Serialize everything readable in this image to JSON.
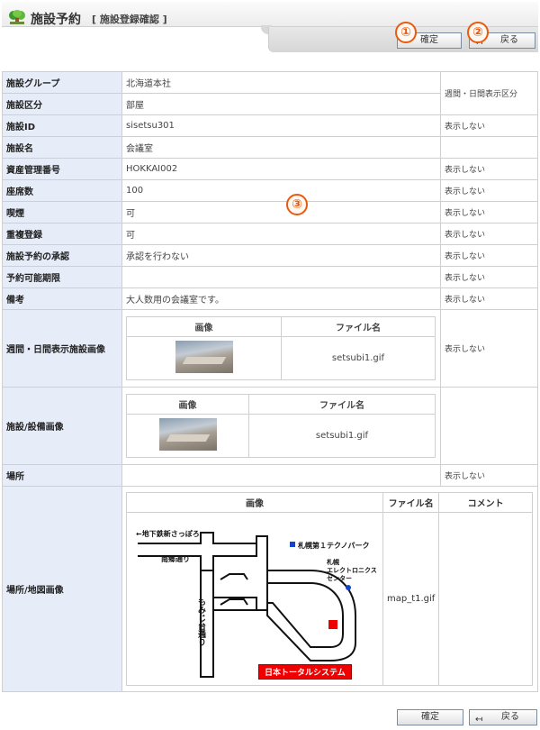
{
  "header": {
    "title": "施設予約",
    "subtitle": "[ 施設登録確認 ]",
    "app_icon": "facility-tree-icon"
  },
  "toolbar": {
    "confirm_label": "確定",
    "back_label": "戻る",
    "back_icon": "return-arrow-icon",
    "badge_1": "①",
    "badge_2": "②"
  },
  "badge_3": "③",
  "table": {
    "display_header": "週間・日間表示区分",
    "rows": [
      {
        "label": "施設グループ",
        "value": "北海道本社",
        "display": ""
      },
      {
        "label": "施設区分",
        "value": "部屋",
        "display": ""
      },
      {
        "label": "施設ID",
        "value": "sisetsu301",
        "display": "表示しない"
      },
      {
        "label": "施設名",
        "value": "会議室",
        "display": ""
      },
      {
        "label": "資産管理番号",
        "value": "HOKKAI002",
        "display": "表示しない"
      },
      {
        "label": "座席数",
        "value": "100",
        "display": "表示しない"
      },
      {
        "label": "喫煙",
        "value": "可",
        "display": "表示しない"
      },
      {
        "label": "重複登録",
        "value": "可",
        "display": "表示しない"
      },
      {
        "label": "施設予約の承認",
        "value": "承認を行わない",
        "display": "表示しない"
      },
      {
        "label": "予約可能期限",
        "value": "",
        "display": "表示しない"
      },
      {
        "label": "備考",
        "value": "大人数用の会議室です。",
        "display": "表示しない"
      }
    ],
    "weekly_image": {
      "label": "週間・日間表示施設画像",
      "col_image": "画像",
      "col_file": "ファイル名",
      "file": "setsubi1.gif",
      "display": "表示しない"
    },
    "equipment_image": {
      "label": "施設/設備画像",
      "col_image": "画像",
      "col_file": "ファイル名",
      "file": "setsubi1.gif"
    },
    "location": {
      "label": "場所",
      "value": "",
      "display": "表示しない"
    },
    "map_image": {
      "label": "場所/地図画像",
      "col_image": "画像",
      "col_file": "ファイル名",
      "col_comment": "コメント",
      "file": "map_t1.gif",
      "comment": "",
      "map_text": {
        "subway": "←地下鉄新さっぽろ",
        "nango": "南郷通り",
        "technopark": "札幌第１テクノパーク",
        "electronics_1": "札幌",
        "electronics_2": "エレクトロニクス",
        "electronics_3": "センター",
        "momiji": "もみじ台通り",
        "company": "日本トータルシステム"
      }
    }
  }
}
